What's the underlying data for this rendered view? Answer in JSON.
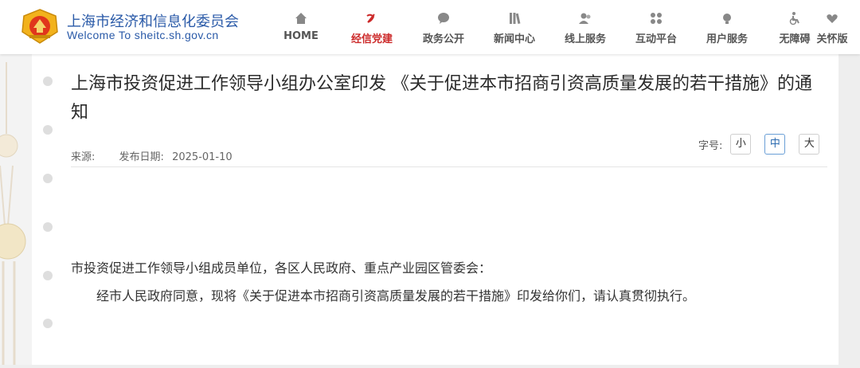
{
  "header": {
    "site_name": "上海市经济和信息化委员会",
    "site_en": "Welcome To sheitc.sh.gov.cn",
    "nav": [
      {
        "label": "HOME",
        "icon": "home-icon"
      },
      {
        "label": "经信党建",
        "icon": "party-icon"
      },
      {
        "label": "政务公开",
        "icon": "chat-icon"
      },
      {
        "label": "新闻中心",
        "icon": "news-icon"
      },
      {
        "label": "线上服务",
        "icon": "users-icon"
      },
      {
        "label": "互动平台",
        "icon": "grid-icon"
      },
      {
        "label": "用户服务",
        "icon": "bulb-icon"
      },
      {
        "label": "无障碍",
        "icon": "wheelchair-icon"
      },
      {
        "label": "关怀版",
        "icon": "heart-icon"
      }
    ],
    "active_nav": "经信党建",
    "colors": {
      "brand": "#2a5aa8",
      "active": "#cc2a2a"
    }
  },
  "article": {
    "title": "上海市投资促进工作领导小组办公室印发 《关于促进本市招商引资高质量发展的若干措施》的通知",
    "source_label": "来源:",
    "date_label": "发布日期:",
    "date": "2025-01-10",
    "font_size_label": "字号:",
    "font_sizes": [
      "小",
      "中",
      "大"
    ],
    "selected_font_size": "中",
    "paragraph_1": "市投资促进工作领导小组成员单位，各区人民政府、重点产业园区管委会：",
    "paragraph_2": "经市人民政府同意，现将《关于促进本市招商引资高质量发展的若干措施》印发给你们，请认真贯彻执行。"
  }
}
